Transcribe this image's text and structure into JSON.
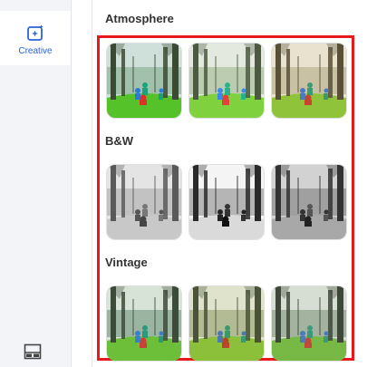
{
  "sidebar": {
    "items": [
      {
        "label": "Creative",
        "icon": "sparkle-image-icon",
        "active": true
      }
    ],
    "bottom_icon": "panel-layout-icon",
    "accent_color": "#2962d9"
  },
  "filters": {
    "sections": [
      {
        "title": "Atmosphere",
        "presets": [
          "color",
          "fresh",
          "warm"
        ]
      },
      {
        "title": "B&W",
        "presets": [
          "soft",
          "contrast",
          "dark"
        ]
      },
      {
        "title": "Vintage",
        "presets": [
          "faded",
          "olive",
          "muted"
        ]
      }
    ],
    "highlight_color": "#e8191b"
  }
}
